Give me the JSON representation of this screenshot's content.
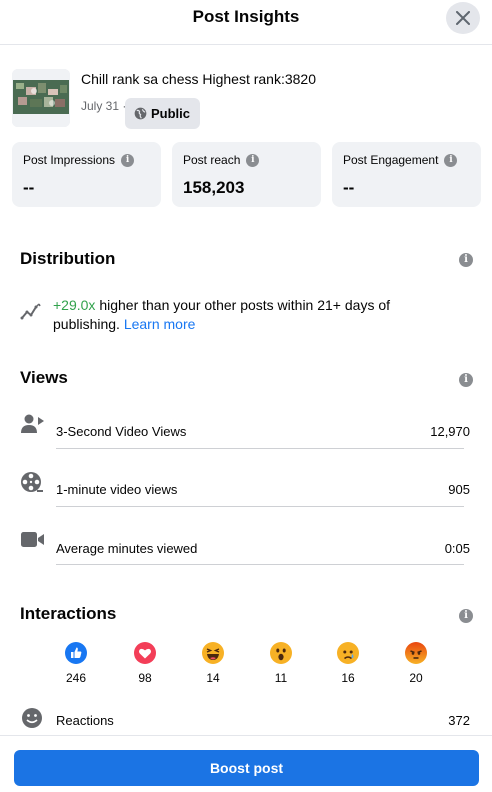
{
  "dialog": {
    "title": "Post Insights"
  },
  "post": {
    "title": "Chill rank sa chess Highest rank:3820",
    "date": "July 31 ·",
    "privacy": "Public"
  },
  "stats": [
    {
      "label": "Post Impressions",
      "value": "--"
    },
    {
      "label": "Post reach",
      "value": "158,203"
    },
    {
      "label": "Post Engagement",
      "value": "--"
    }
  ],
  "distribution": {
    "title": "Distribution",
    "highlight": "+29.0x",
    "text": " higher than your other posts within 21+ days of publishing. ",
    "link": "Learn more"
  },
  "views": {
    "title": "Views",
    "rows": [
      {
        "icon": "person-video-icon",
        "label": "3-Second Video Views",
        "value": "12,970"
      },
      {
        "icon": "film-reel-icon",
        "label": "1-minute video views",
        "value": "905"
      },
      {
        "icon": "video-camera-icon",
        "label": "Average minutes viewed",
        "value": "0:05"
      }
    ]
  },
  "interactions": {
    "title": "Interactions",
    "reactions": [
      {
        "type": "like",
        "count": "246",
        "color": "#1877f2"
      },
      {
        "type": "love",
        "count": "98",
        "color": "#f33e58"
      },
      {
        "type": "haha",
        "count": "14",
        "color": "#f7b125"
      },
      {
        "type": "wow",
        "count": "11",
        "color": "#f7b125"
      },
      {
        "type": "sad",
        "count": "16",
        "color": "#f7b125"
      },
      {
        "type": "angry",
        "count": "20",
        "color": "#e9710f"
      }
    ],
    "summary": {
      "label": "Reactions",
      "value": "372"
    }
  },
  "footer": {
    "boost_label": "Boost post"
  },
  "colors": {
    "accent": "#1b74e4",
    "positive": "#31a24c",
    "link": "#1877f2"
  }
}
